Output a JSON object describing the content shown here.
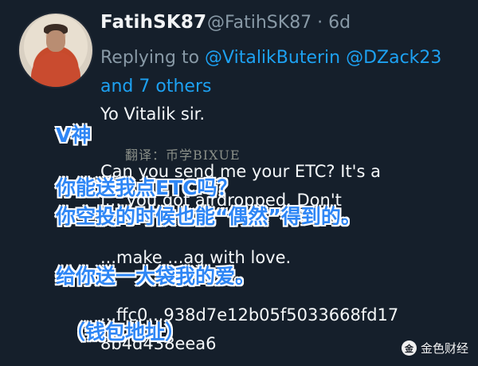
{
  "tweet": {
    "display_name": "FatihSK87",
    "handle_time": "@FatihSK87 · 6d",
    "reply_prefix": "Replying to ",
    "mention_1": "@VitalikButerin",
    "mention_2": "@DZack23",
    "mention_3": "and 7 others",
    "line_1": "Yo Vitalik sir.",
    "line_2": "Can you send me your ETC? It's a",
    "line_3": "f... you got airdropped. Don't",
    "line_4": "...make ...ag with love.",
    "line_5": "...ffc0...938d7e12b05f5033668fd17",
    "line_6": "8b4d438eea6"
  },
  "watermark": "翻译：币学BIXUE",
  "overlays": {
    "line_1": "V神",
    "line_2": "你能送我点ETC吗？",
    "line_3": "你空投的时候也能“偶然”得到的。",
    "line_4": "给你送一大袋我的爱。",
    "line_5": "（钱包地址）"
  },
  "brand": {
    "icon": "jinse-finance-icon",
    "label": "金色财经"
  },
  "colors": {
    "background": "#151f2b",
    "link": "#1da1f2",
    "overlay_text": "#2e86f5",
    "overlay_outline": "#ffffff"
  }
}
